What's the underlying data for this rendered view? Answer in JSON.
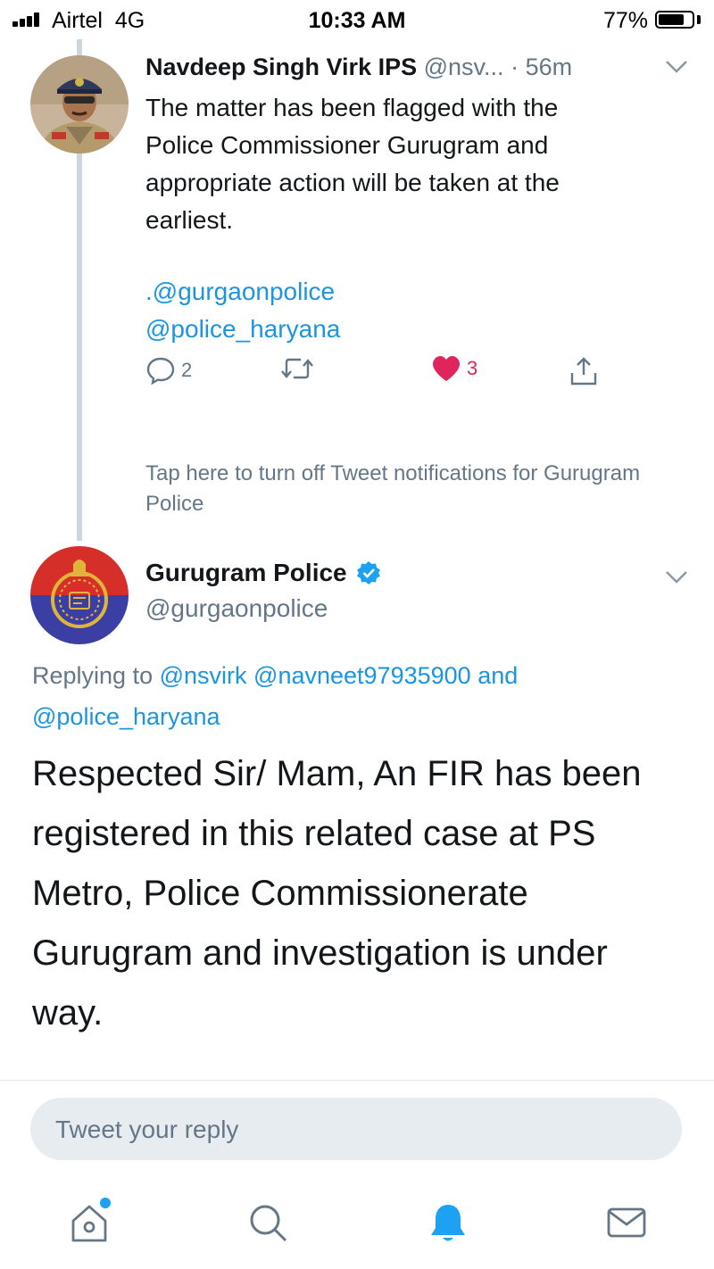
{
  "status_bar": {
    "carrier": "Airtel",
    "network": "4G",
    "time": "10:33 AM",
    "battery_percent": "77%",
    "battery_level": 0.77
  },
  "tweet1": {
    "author_name": "Navdeep Singh Virk IPS",
    "handle": "@nsv...",
    "time": "· 56m",
    "text": "The matter has been flagged with the\nPolice Commissioner Gurugram and\nappropriate action will be taken at the\nearliest.",
    "mentions": [
      ".@gurgaonpolice",
      "@police_haryana"
    ],
    "reply_count": "2",
    "like_count": "3"
  },
  "notification_text": "Tap here to turn off Tweet notifications for Gurugram Police",
  "tweet2": {
    "author_name": "Gurugram Police",
    "handle": "@gurgaonpolice",
    "verified": true,
    "replying_prefix": "Replying to",
    "replying_users": [
      "@nsvirk",
      "@navneet97935900"
    ],
    "replying_and": "and",
    "replying_last": "@police_haryana",
    "text": "Respected Sir/ Mam, An FIR has been registered in this related case at PS Metro, Police Commissionerate Gurugram and investigation is under way."
  },
  "reply_box": {
    "placeholder": "Tweet your reply"
  },
  "tabbar": {
    "icons": [
      "home-icon",
      "search-icon",
      "notifications-icon",
      "messages-icon"
    ],
    "accent": "#1da1f2"
  },
  "colors": {
    "link": "#1b95e0",
    "muted": "#657786",
    "like": "#e0245e"
  }
}
